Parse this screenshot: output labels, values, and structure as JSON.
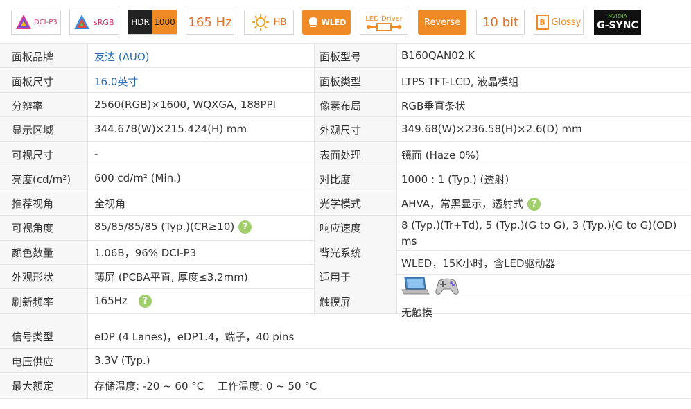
{
  "badges": {
    "dci_p3": "DCI-P3",
    "srgb": "sRGB",
    "hdr": "HDR",
    "hdr_level": "1000",
    "hz": "165 Hz",
    "hb": "HB",
    "wled": "WLED",
    "led_driver": "LED Driver",
    "reverse": "Reverse",
    "bit": "10 bit",
    "glossy": "Glossy",
    "nvidia": "NVIDIA",
    "gsync": "G-SYNC"
  },
  "colors": {
    "blue_value": "#2a6db5",
    "orange": "#f08a24",
    "green_help": "#9fce6a"
  },
  "specs": {
    "brand_label": "面板品牌",
    "brand_value": "友达 (AUO)",
    "model_label": "面板型号",
    "model_value": "B160QAN02.K",
    "size_label": "面板尺寸",
    "size_value": "16.0英寸",
    "type_label": "面板类型",
    "type_value": "LTPS TFT-LCD, 液晶模组",
    "res_label": "分辨率",
    "res_value": "2560(RGB)×1600, WQXGA, 188PPI",
    "pixel_label": "像素布局",
    "pixel_value": "RGB垂直条状",
    "area_label": "显示区域",
    "area_value": "344.678(W)×215.424(H) mm",
    "outline_label": "外观尺寸",
    "outline_value": "349.68(W)×236.58(H)×2.6(D) mm",
    "viewsize_label": "可视尺寸",
    "viewsize_value": "-",
    "surface_label": "表面处理",
    "surface_value": "镜面 (Haze 0%)",
    "bright_label": "亮度(cd/m²)",
    "bright_value": "600 cd/m² (Min.)",
    "contrast_label": "对比度",
    "contrast_value": "1000 : 1 (Typ.) (透射)",
    "recview_label": "推荐视角",
    "recview_value": "全视角",
    "optical_label": "光学模式",
    "optical_value": "AHVA，常黑显示，透射式",
    "angle_label": "可视角度",
    "angle_value": "85/85/85/85 (Typ.)(CR≥10)",
    "response_label": "响应速度",
    "response_value_1": "8 (Typ.)(Tr+Td), 5 (Typ.)(G to G), 3 (Typ.)(G to G)(OD)",
    "response_value_2": "ms",
    "colors_label": "颜色数量",
    "colors_value": "1.06B，96% DCI-P3",
    "backlight_label": "背光系统",
    "backlight_value": "WLED，15K小时，含LED驱动器",
    "shape_label": "外观形状",
    "shape_value": "薄屏 (PCBA平直, 厚度≤3.2mm)",
    "apply_label": "适用于",
    "refresh_label": "刷新频率",
    "refresh_value": "165Hz",
    "touch_label": "触摸屏",
    "touch_value": "无触摸",
    "signal_label": "信号类型",
    "signal_value": "eDP (4 Lanes)，eDP1.4，端子，40 pins",
    "voltage_label": "电压供应",
    "voltage_value": "3.3V (Typ.)",
    "maxrate_label": "最大额定",
    "maxrate_value": "存储温度: -20 ~ 60 °C　 工作温度: 0 ~ 50 °C",
    "help_symbol": "?"
  }
}
